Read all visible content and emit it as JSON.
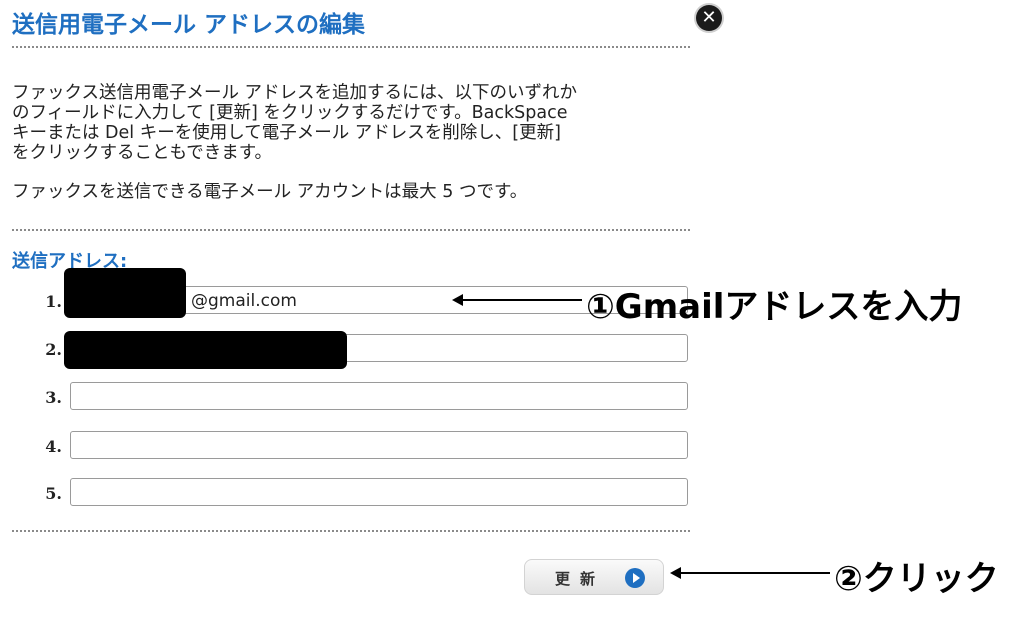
{
  "dialog": {
    "title": "送信用電子メール アドレスの編集",
    "close_glyph": "✕",
    "description": "ファックス送信用電子メール アドレスを追加するには、以下のいずれか\nのフィールドに入力して [更新] をクリックするだけです。BackSpace\nキーまたは Del キーを使用して電子メール アドレスを削除し、[更新]\nをクリックすることもできます。",
    "limit_note": "ファックスを送信できる電子メール アカウントは最大 5 つです。",
    "section_label": "送信アドレス:",
    "addresses": [
      {
        "number": "1.",
        "value": "@gmail.com"
      },
      {
        "number": "2.",
        "value": ""
      },
      {
        "number": "3.",
        "value": ""
      },
      {
        "number": "4.",
        "value": ""
      },
      {
        "number": "5.",
        "value": ""
      }
    ],
    "update_button": {
      "label": "更新",
      "icon": "play-circle-icon"
    }
  },
  "annotations": {
    "step1": "①Gmailアドレスを入力",
    "step2": "②クリック"
  },
  "colors": {
    "accent": "#1f6fc1",
    "text": "#222222",
    "redaction": "#000000"
  }
}
